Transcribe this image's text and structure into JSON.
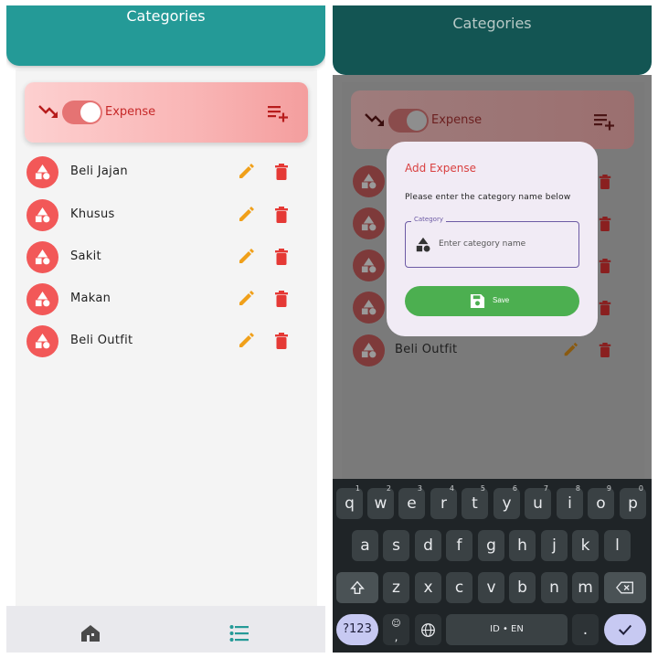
{
  "left_screen": {
    "app_bar": {
      "title": "Categories"
    },
    "type_toggle": {
      "label": "Expense",
      "on": true
    },
    "categories": [
      {
        "name": "Beli Jajan"
      },
      {
        "name": "Khusus"
      },
      {
        "name": "Sakit"
      },
      {
        "name": "Makan"
      },
      {
        "name": "Beli Outfit"
      }
    ],
    "bottom_nav": [
      {
        "icon": "home-icon",
        "active": false
      },
      {
        "icon": "list-icon",
        "active": true
      }
    ]
  },
  "right_screen": {
    "app_bar": {
      "title": "Categories"
    },
    "type_toggle": {
      "label": "Expense"
    },
    "visible_category": {
      "name": "Beli Outfit"
    },
    "dialog": {
      "title": "Add Expense",
      "message": "Please enter the category name below",
      "field_label": "Category",
      "input_value": "",
      "input_placeholder": "Enter category name",
      "save_label": "Save"
    },
    "keyboard": {
      "row1": [
        {
          "key": "q",
          "hint": "1"
        },
        {
          "key": "w",
          "hint": "2"
        },
        {
          "key": "e",
          "hint": "3"
        },
        {
          "key": "r",
          "hint": "4"
        },
        {
          "key": "t",
          "hint": "5"
        },
        {
          "key": "y",
          "hint": "6"
        },
        {
          "key": "u",
          "hint": "7"
        },
        {
          "key": "i",
          "hint": "8"
        },
        {
          "key": "o",
          "hint": "9"
        },
        {
          "key": "p",
          "hint": "0"
        }
      ],
      "row2": [
        "a",
        "s",
        "d",
        "f",
        "g",
        "h",
        "j",
        "k",
        "l"
      ],
      "row3": [
        "z",
        "x",
        "c",
        "v",
        "b",
        "n",
        "m"
      ],
      "symbols_label": "?123",
      "comma_label": ",",
      "space_label": "ID • EN",
      "period_label": "."
    }
  },
  "colors": {
    "app_bar": "#249a97",
    "expense_red": "#f25858",
    "edit_orange": "#f0a01a",
    "delete_red": "#e53935",
    "save_green": "#4caf50",
    "dialog_bg": "#f1ebf5"
  }
}
